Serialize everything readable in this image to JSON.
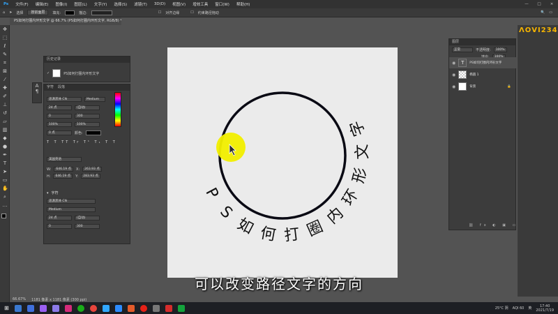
{
  "menubar": {
    "items": [
      "文件(F)",
      "编辑(E)",
      "图像(I)",
      "图层(L)",
      "文字(Y)",
      "选择(S)",
      "滤镜(T)",
      "3D(D)",
      "视图(V)",
      "增效工具",
      "窗口(W)",
      "帮助(H)"
    ],
    "window_controls": [
      "—",
      "□",
      "×"
    ]
  },
  "options_bar": {
    "select_label": "选择",
    "mode_chip": "按前面层",
    "fill_label": "填充:",
    "stroke_label": "描边:",
    "align_label": "对齐边缘",
    "constrain_label": "约束路径拖动"
  },
  "document_tab": {
    "title": "PS如何打圈内环形文字 @ 66.7% (PS如何打圈内环形文字, RGB/8) *"
  },
  "canvas": {
    "curved_text": [
      "P",
      "S",
      "如",
      "何",
      "打",
      "圈",
      "内",
      "环",
      "形",
      "文",
      "字"
    ],
    "circle_color": "#0a0a14",
    "background": "#ebebeb"
  },
  "subtitle": {
    "text": "可以改变路径文字的方向"
  },
  "history_panel": {
    "title": "历史记录",
    "entry": "PS如何打圈内环形文字"
  },
  "character_panel": {
    "tabs": [
      "字符",
      "段落"
    ],
    "font_family": "思源黑体 CN",
    "font_style": "Medium",
    "font_size": "24 点",
    "leading": "(自动)",
    "kerning": "0",
    "tracking": "300",
    "vertical_scale": "100%",
    "horizontal_scale": "100%",
    "baseline": "0 点",
    "color_label": "颜色:",
    "language": "美国英语",
    "w_label": "W:",
    "w_value": "646.19 点",
    "x_label": "X:",
    "x_value": "263.93 点",
    "h_label": "H:",
    "h_value": "646.19 点",
    "y_label": "Y:",
    "y_value": "283.93 点",
    "section2_title": "字符",
    "font_family_2": "思源黑体 CN",
    "font_style_2": "Medium",
    "font_size_2": "24 点",
    "leading_2": "(自动)",
    "tracking_2": "300",
    "kerning_2": "0"
  },
  "layers_panel": {
    "tab": "图层",
    "blend_mode": "正常",
    "opacity_label": "不透明度:",
    "opacity_value": "100%",
    "fill_label": "填充:",
    "fill_value": "100%",
    "layers": [
      {
        "name": "PS如何打圈内环形文字",
        "type": "text",
        "thumb_glyph": "T"
      },
      {
        "name": "椭圆 1",
        "type": "shape",
        "thumb_glyph": ""
      },
      {
        "name": "背景",
        "type": "background",
        "thumb_glyph": ""
      }
    ]
  },
  "status_bar": {
    "zoom": "66.67%",
    "doc_size": "1181 像素 x 1181 像素 (300 ppi)"
  },
  "watermark": {
    "text": "ΛΟVΙ234"
  },
  "taskbar": {
    "weather": "25°C 阴",
    "time": "17:40",
    "date": "2021/7/19",
    "ime": "英",
    "aqi": "AQI 60"
  }
}
